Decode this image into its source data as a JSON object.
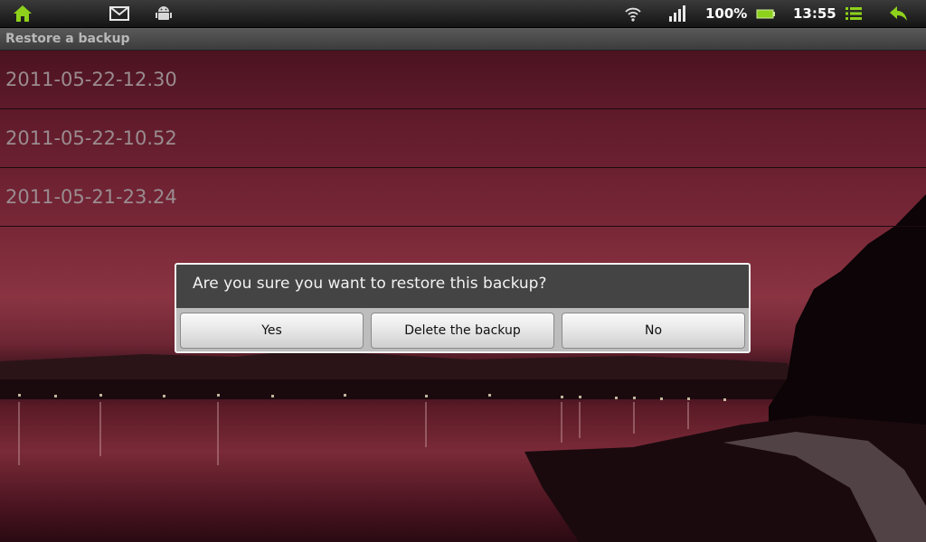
{
  "status_bar": {
    "icons_left": [
      "home-icon",
      "gmail-icon",
      "android-debug-icon"
    ],
    "icons_right": [
      "wifi-icon",
      "signal-icon",
      "battery-icon",
      "menu-icon",
      "back-icon"
    ],
    "battery_percent": "100%",
    "battery_level": 1.0,
    "time": "13:55",
    "accent_color": "#8ed11c"
  },
  "title_bar": {
    "title": "Restore a backup"
  },
  "backups": [
    {
      "label": "2011-05-22-12.30"
    },
    {
      "label": "2011-05-22-10.52"
    },
    {
      "label": "2011-05-21-23.24"
    }
  ],
  "dialog": {
    "message": "Are you sure you want to restore this backup?",
    "buttons": {
      "yes": "Yes",
      "delete": "Delete the backup",
      "no": "No"
    }
  }
}
